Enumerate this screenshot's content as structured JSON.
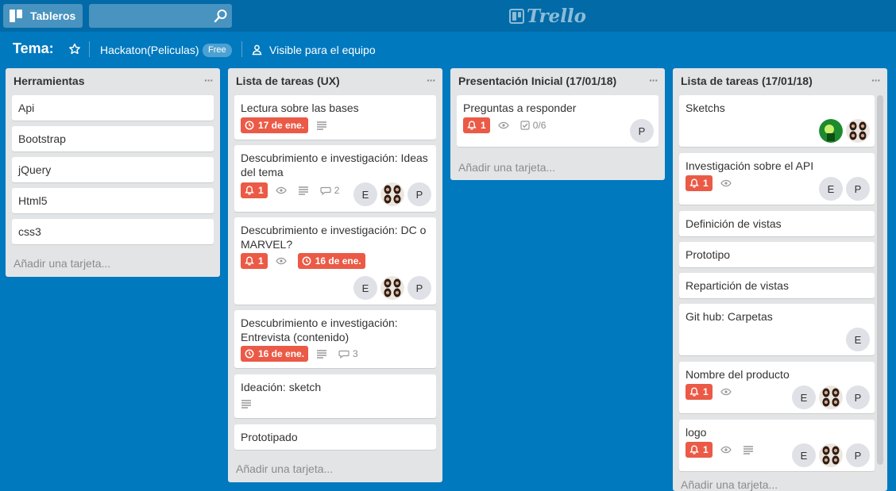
{
  "topbar": {
    "boards_label": "Tableros",
    "search_value": "",
    "logo_text": "Trello"
  },
  "board": {
    "title": "Tema:",
    "team": "Hackaton(Peliculas)",
    "team_badge": "Free",
    "visibility": "Visible para el equipo"
  },
  "lists": [
    {
      "title": "Herramientas",
      "menu": "···",
      "add_card": "Añadir una tarjeta...",
      "cards": [
        {
          "title": "Api"
        },
        {
          "title": "Bootstrap"
        },
        {
          "title": "jQuery"
        },
        {
          "title": "Html5"
        },
        {
          "title": "css3"
        }
      ]
    },
    {
      "title": "Lista de tareas (UX)",
      "menu": "···",
      "add_card": "Añadir una tarjeta...",
      "cards": [
        {
          "title": "Lectura sobre las bases",
          "due": "17 de ene."
        },
        {
          "title": "Descubrimiento e investigación: Ideas del tema",
          "notifications": "1",
          "comments": "2",
          "member_initials": [
            "E",
            "P"
          ]
        },
        {
          "title": "Descubrimiento e investigación: DC o MARVEL?",
          "notifications": "1",
          "due": "16 de ene.",
          "member_initials": [
            "E",
            "P"
          ]
        },
        {
          "title": "Descubrimiento e investigación: Entrevista (contenido)",
          "due": "16 de ene.",
          "comments": "3"
        },
        {
          "title": "Ideación: sketch"
        },
        {
          "title": "Prototipado"
        }
      ]
    },
    {
      "title": "Presentación Inicial (17/01/18)",
      "menu": "···",
      "add_card": "Añadir una tarjeta...",
      "cards": [
        {
          "title": "Preguntas a responder",
          "notifications": "1",
          "checklist": "0/6",
          "member_initials": [
            "P"
          ]
        }
      ]
    },
    {
      "title": "Lista de tareas (17/01/18)",
      "menu": "···",
      "add_card": "Añadir una tarjeta...",
      "cards": [
        {
          "title": "Sketchs"
        },
        {
          "title": "Investigación sobre el API",
          "notifications": "1",
          "member_initials": [
            "E",
            "P"
          ]
        },
        {
          "title": "Definición de vistas"
        },
        {
          "title": "Prototipo"
        },
        {
          "title": "Repartición de vistas"
        },
        {
          "title": "Git hub: Carpetas",
          "member_initials": [
            "E"
          ]
        },
        {
          "title": "Nombre del producto",
          "notifications": "1",
          "member_initials": [
            "E",
            "P"
          ]
        },
        {
          "title": "logo",
          "notifications": "1",
          "member_initials": [
            "E",
            "P"
          ]
        }
      ]
    }
  ],
  "colors": {
    "background": "#0079bf",
    "header": "#026aa7",
    "list": "#e2e4e6",
    "badge_red": "#eb5a46"
  },
  "icons": [
    "boards-icon",
    "search-icon",
    "star-icon",
    "team-icon",
    "bell-icon",
    "eye-icon",
    "description-icon",
    "comment-icon",
    "clock-icon",
    "checklist-icon",
    "avatar-photo"
  ]
}
